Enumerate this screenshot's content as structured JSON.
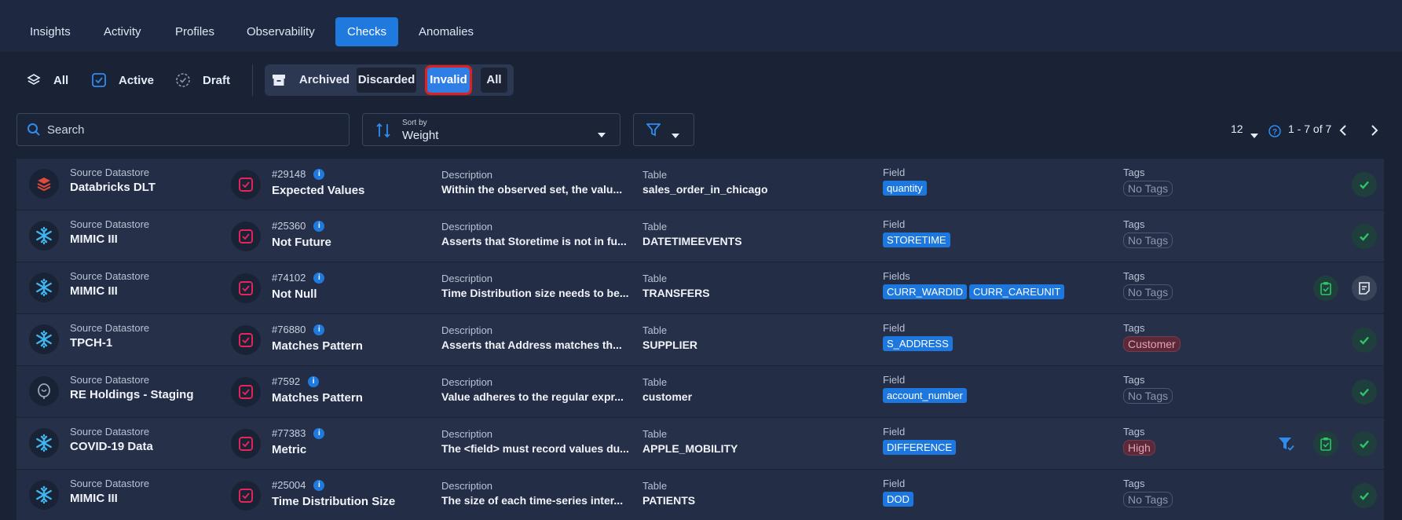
{
  "tabs": [
    {
      "label": "Insights",
      "active": false
    },
    {
      "label": "Activity",
      "active": false
    },
    {
      "label": "Profiles",
      "active": false
    },
    {
      "label": "Observability",
      "active": false
    },
    {
      "label": "Checks",
      "active": true
    },
    {
      "label": "Anomalies",
      "active": false
    }
  ],
  "status_filters": {
    "all": "All",
    "active": "Active",
    "draft": "Draft",
    "archived": "Archived",
    "discarded": "Discarded",
    "invalid": "Invalid",
    "all_archived": "All"
  },
  "toolbar": {
    "search_placeholder": "Search",
    "sort_label": "Sort by",
    "sort_value": "Weight",
    "page_size": "12",
    "pagination": "1 - 7 of 7"
  },
  "columns": {
    "datastore": "Source Datastore",
    "description": "Description",
    "table": "Table",
    "field": "Field",
    "fields": "Fields",
    "tags": "Tags"
  },
  "colors": {
    "accent": "#1f7ae0",
    "highlight": "#e0201d",
    "success": "#2ec46a",
    "check_icon": "#e8245d"
  },
  "rows": [
    {
      "datastore": "Databricks DLT",
      "ds_icon": "databricks-icon",
      "id": "#29148",
      "check": "Expected Values",
      "description": "Within the observed set, the valu...",
      "table": "sales_order_in_chicago",
      "field_label": "Field",
      "fields": [
        "quantity"
      ],
      "tags": [
        "No Tags"
      ],
      "tag_style": "empty",
      "actions": [
        "approve-icon"
      ]
    },
    {
      "datastore": "MIMIC III",
      "ds_icon": "snowflake-icon",
      "id": "#25360",
      "check": "Not Future",
      "description": "Asserts that Storetime is not in fu...",
      "table": "DATETIMEEVENTS",
      "field_label": "Field",
      "fields": [
        "STORETIME"
      ],
      "tags": [
        "No Tags"
      ],
      "tag_style": "empty",
      "actions": [
        "approve-icon"
      ]
    },
    {
      "datastore": "MIMIC III",
      "ds_icon": "snowflake-icon",
      "id": "#74102",
      "check": "Not Null",
      "description": "Time Distribution size needs to be...",
      "table": "TRANSFERS",
      "field_label": "Fields",
      "fields": [
        "CURR_WARDID",
        "CURR_CAREUNIT"
      ],
      "tags": [
        "No Tags"
      ],
      "tag_style": "empty",
      "actions": [
        "clipboard-check-icon",
        "note-icon"
      ]
    },
    {
      "datastore": "TPCH-1",
      "ds_icon": "snowflake-icon",
      "id": "#76880",
      "check": "Matches Pattern",
      "description": "Asserts that Address matches th...",
      "table": "SUPPLIER",
      "field_label": "Field",
      "fields": [
        "S_ADDRESS"
      ],
      "tags": [
        "Customer"
      ],
      "tag_style": "red",
      "actions": [
        "approve-icon"
      ]
    },
    {
      "datastore": "RE Holdings - Staging",
      "ds_icon": "postgres-icon",
      "id": "#7592",
      "check": "Matches Pattern",
      "description": "Value adheres to the regular expr...",
      "table": "customer",
      "field_label": "Field",
      "fields": [
        "account_number"
      ],
      "tags": [
        "No Tags"
      ],
      "tag_style": "empty",
      "actions": [
        "approve-icon"
      ]
    },
    {
      "datastore": "COVID-19 Data",
      "ds_icon": "snowflake-icon",
      "id": "#77383",
      "check": "Metric",
      "description": "The <field> must record values du...",
      "table": "APPLE_MOBILITY",
      "field_label": "Field",
      "fields": [
        "DIFFERENCE"
      ],
      "tags": [
        "High"
      ],
      "tag_style": "red",
      "actions": [
        "filter-check-icon",
        "clipboard-check-icon",
        "approve-icon"
      ]
    },
    {
      "datastore": "MIMIC III",
      "ds_icon": "snowflake-icon",
      "id": "#25004",
      "check": "Time Distribution Size",
      "description": "The size of each time-series inter...",
      "table": "PATIENTS",
      "field_label": "Field",
      "fields": [
        "DOD"
      ],
      "tags": [
        "No Tags"
      ],
      "tag_style": "empty",
      "actions": [
        "approve-icon"
      ]
    }
  ]
}
